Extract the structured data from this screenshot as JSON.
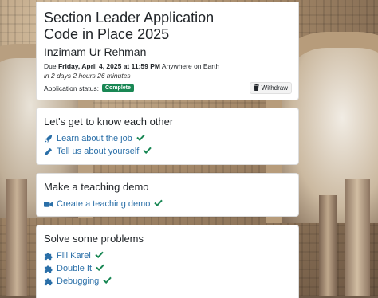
{
  "application": {
    "title_line1": "Section Leader Application",
    "title_line2": "Code in Place 2025",
    "applicant": "Inzimam Ur Rehman",
    "due_prefix": "Due",
    "due_date": "Friday, April 4, 2025 at 11:59 PM",
    "due_zone": "Anywhere on Earth",
    "time_remaining": "in 2 days 2 hours 26 minutes",
    "status_label": "Application status:",
    "status_value": "Complete",
    "withdraw_label": "Withdraw"
  },
  "sections": [
    {
      "heading": "Let's get to know each other",
      "tasks": [
        {
          "label": "Learn about the job",
          "icon": "rocket-icon",
          "done": true
        },
        {
          "label": "Tell us about yourself",
          "icon": "pencil-icon",
          "done": true
        }
      ]
    },
    {
      "heading": "Make a teaching demo",
      "tasks": [
        {
          "label": "Create a teaching demo",
          "icon": "video-icon",
          "done": true
        }
      ]
    },
    {
      "heading": "Solve some problems",
      "tasks": [
        {
          "label": "Fill Karel",
          "icon": "puzzle-icon",
          "done": true
        },
        {
          "label": "Double It",
          "icon": "puzzle-icon",
          "done": true
        },
        {
          "label": "Debugging",
          "icon": "puzzle-icon",
          "done": true
        }
      ]
    }
  ],
  "colors": {
    "link": "#2a6fa8",
    "check": "#198754",
    "badge": "#198754"
  }
}
